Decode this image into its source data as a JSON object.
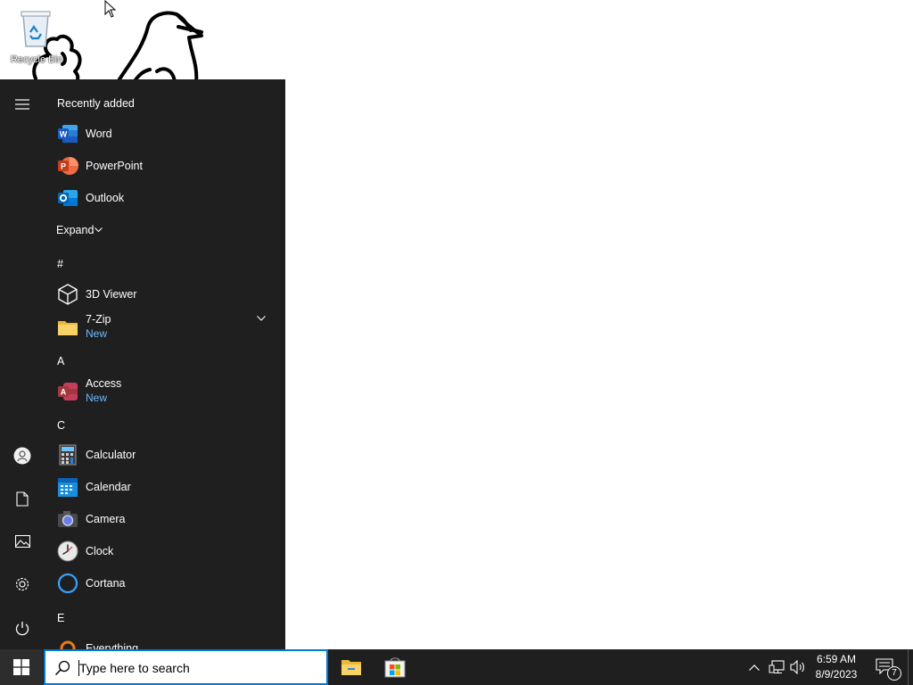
{
  "desktop": {
    "recycle_bin_label": "Recycle Bin"
  },
  "start_menu": {
    "recently_added_header": "Recently added",
    "recent_apps": [
      {
        "name": "Word",
        "icon": "word-icon"
      },
      {
        "name": "PowerPoint",
        "icon": "powerpoint-icon"
      },
      {
        "name": "Outlook",
        "icon": "outlook-icon"
      }
    ],
    "expand_label": "Expand",
    "sections": {
      "hash": "#",
      "a": "A",
      "c": "C",
      "e": "E"
    },
    "apps": {
      "viewer3d": {
        "name": "3D Viewer"
      },
      "sevenzip": {
        "name": "7-Zip",
        "badge": "New"
      },
      "access": {
        "name": "Access",
        "badge": "New"
      },
      "calculator": {
        "name": "Calculator"
      },
      "calendar": {
        "name": "Calendar"
      },
      "camera": {
        "name": "Camera"
      },
      "clock": {
        "name": "Clock"
      },
      "cortana": {
        "name": "Cortana"
      },
      "everything": {
        "name": "Everything"
      }
    },
    "rail_icons": [
      "hamburger-menu-icon",
      "user-icon",
      "documents-icon",
      "pictures-icon",
      "settings-icon",
      "power-icon"
    ]
  },
  "taskbar": {
    "search_placeholder": "Type here to search",
    "pinned": [
      "file-explorer-icon",
      "microsoft-store-icon"
    ],
    "time": "6:59 AM",
    "date": "8/9/2023",
    "notification_count": "7"
  },
  "colors": {
    "start_menu_bg": "#1f1f1f",
    "accent": "#0078d7",
    "new_badge": "#6cb8ff"
  }
}
